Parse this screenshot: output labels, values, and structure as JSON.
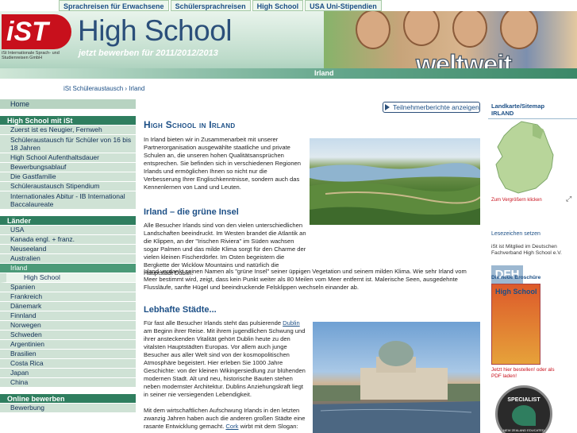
{
  "topnav": [
    "Sprachreisen für Erwachsene",
    "Schülersprachreisen",
    "High School",
    "USA Uni-Stipendien"
  ],
  "header": {
    "logo_text": "iST",
    "logo_sub": "iSt Internationale Sprach- und Studienreisen GmbH",
    "title": "High School",
    "apply_prefix": "jetzt bewerben für",
    "apply_years": "2011/2012/2013",
    "weltweit": "weltweit",
    "current_section": "Irland"
  },
  "breadcrumb": {
    "parent": "iSt Schüleraustausch",
    "sep": "›",
    "current": "Irland"
  },
  "sidebar": {
    "home": "Home",
    "group1_head": "High School mit iSt",
    "group1_items": [
      "Zuerst ist es Neugier, Fernweh",
      "Schüleraustausch für Schüler von 16 bis 18 Jahren",
      "High School Aufenthaltsdauer",
      "Bewerbungsablauf",
      "Die Gastfamilie",
      "Schüleraustausch Stipendium",
      "Internationales Abitur - IB International Baccalaureate"
    ],
    "countries_head": "Länder",
    "countries": [
      "USA",
      "Kanada engl. + franz.",
      "Neuseeland",
      "Australien",
      "Irland"
    ],
    "irland_sub": "High School",
    "countries_rest": [
      "Spanien",
      "Frankreich",
      "Dänemark",
      "Finnland",
      "Norwegen",
      "Schweden",
      "Argentinien",
      "Brasilien",
      "Costa Rica",
      "Japan",
      "China"
    ],
    "apply_head": "Online bewerben",
    "apply_items": [
      "Bewerbung"
    ]
  },
  "main": {
    "report_button": "Teilnehmerberichte anzeigen",
    "title": "High School in Irland",
    "intro": "In Irland bieten wir in Zusammenarbeit mit unserer Partnerorganisation ausgewählte staatliche und private Schulen an, die unseren hohen Qualitätsansprüchen entsprechen. Sie befinden sich in verschiedenen Regionen Irlands und ermöglichen Ihnen so nicht nur die Verbesserung Ihrer Englischkenntnisse, sondern auch das Kennenlernen von Land und Leuten.",
    "sub1": "Irland – die grüne Insel",
    "p1": "Alle Besucher Irlands sind von den vielen unterschiedlichen Landschaften beeindruckt. Im Westen brandet die Atlantik an die Klippen, an der \"Irischen Riviera\" im Süden wachsen sogar Palmen und das milde Klima sorgt für den Charme der vielen kleinen Fischerdörfer. Im Osten begeistern die Bergkette der Wicklow Mountains und natürlich die Hauptstadt Dublin.",
    "p2": "Irland verdankt seinen Namen als \"grüne Insel\" seiner üppigen Vegetation und seinem milden Klima. Wie sehr Irland vom Meer bestimmt wird, zeigt, dass kein Punkt weiter als 80 Meilen vom Meer entfernt ist. Malerische Seen, ausgedehnte Flussläufe, sanfte Hügel und beeindruckende Felsklippen wechseln einander ab.",
    "sub2": "Lebhafte Städte...",
    "p3_a": "Für fast alle Besucher Irlands steht das pulsierende ",
    "p3_link": "Dublin",
    "p3_b": " am Beginn ihrer Reise. Mit ihrem jugendlichen Schwung und ihrer ansteckenden Vitalität gehört Dublin heute zu den vitalsten Hauptstädten Europas. Vor allem auch junge Besucher aus aller Welt sind von der kosmopolitischen Atmosphäre begeistert. Hier erleben Sie 1000 Jahre Geschichte: von der kleinen Wikingersiedlung zur blühenden modernen Stadt. Alt und neu, historische Bauten stehen neben modernster Architektur. Dublins Anziehungskraft liegt in seiner nie versiegenden Lebendigkeit.",
    "p4_a": "Mit dem wirtschaftlichen Aufschwung Irlands in den letzten zwanzig Jahren haben auch die anderen großen Städte eine rasante Entwicklung gemacht. ",
    "p4_link": "Cork",
    "p4_b": " wirbt mit dem Slogan:"
  },
  "rightbar": {
    "map_title": "Landkarte/Sitemap",
    "map_sub": "IRLAND",
    "map_zoom": "Zum Vergrößern klicken",
    "bookmarks": "Lesezeichen setzen",
    "member_text": "iSt ist Mitglied im Deutschen Fachverband High School e.V.",
    "dfh": "DFH",
    "brochure_title": "Die neue Broschüre",
    "brochure_cover_title": "High School",
    "brochure_caption": "Jetzt hier bestellen! oder als PDF laden!",
    "badge_top": "SPECIALIST",
    "badge_bottom": "NEW ZEALAND EDUCATED"
  },
  "colors": {
    "brand_red": "#c8101c",
    "nav_blue": "#1c4f86",
    "sidebar_green": "#2f7e5f",
    "sidebar_light": "#cfe2d5"
  }
}
